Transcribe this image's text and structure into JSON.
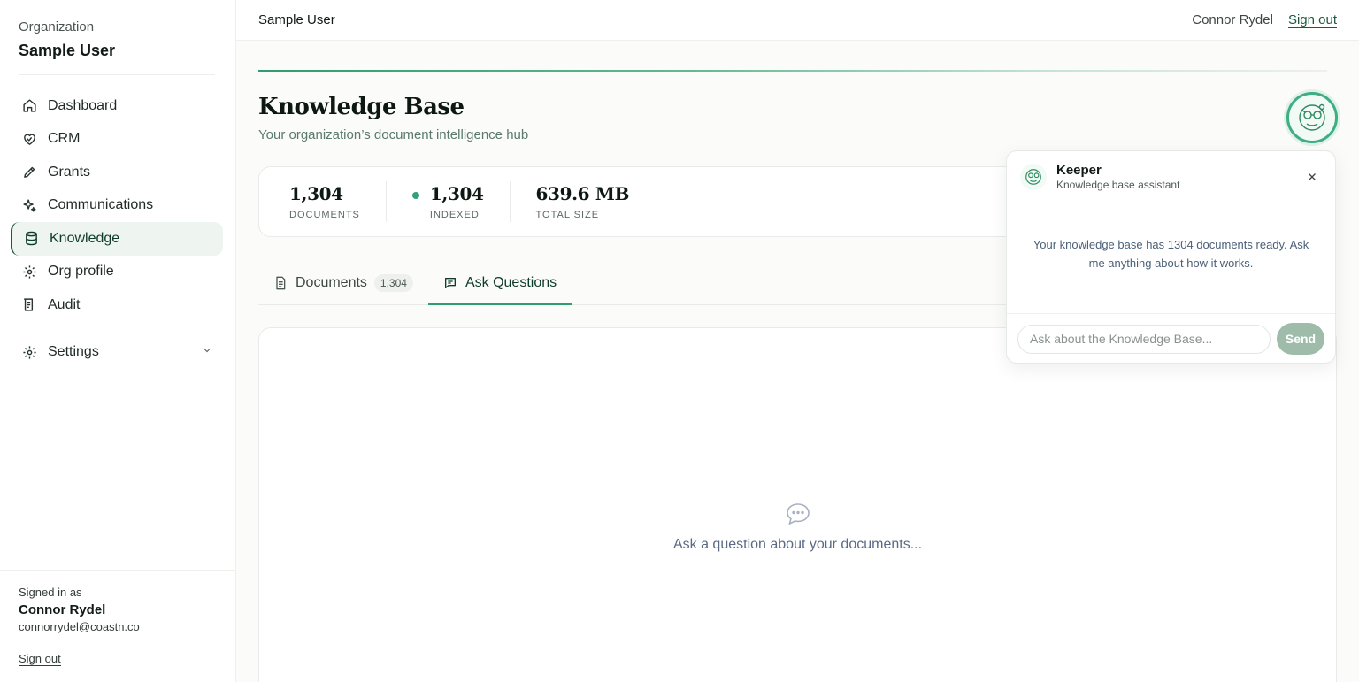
{
  "sidebar": {
    "org_label": "Organization",
    "org_name": "Sample User",
    "items": [
      {
        "label": "Dashboard",
        "icon": "home-icon"
      },
      {
        "label": "CRM",
        "icon": "handshake-icon"
      },
      {
        "label": "Grants",
        "icon": "pen-icon"
      },
      {
        "label": "Communications",
        "icon": "sparkle-icon"
      },
      {
        "label": "Knowledge",
        "icon": "database-icon",
        "active": true
      },
      {
        "label": "Org profile",
        "icon": "gear-icon"
      },
      {
        "label": "Audit",
        "icon": "audit-icon"
      }
    ],
    "settings_label": "Settings",
    "signed_in_label": "Signed in as",
    "user_name": "Connor Rydel",
    "user_email": "connorrydel@coastn.co",
    "sign_out": "Sign out"
  },
  "topbar": {
    "title": "Sample User",
    "user": "Connor Rydel",
    "sign_out": "Sign out"
  },
  "page": {
    "title": "Knowledge Base",
    "subtitle": "Your organization’s document intelligence hub"
  },
  "stats": {
    "documents_value": "1,304",
    "documents_label": "DOCUMENTS",
    "indexed_value": "1,304",
    "indexed_label": "INDEXED",
    "size_value": "639.6 MB",
    "size_label": "TOTAL SIZE"
  },
  "tabs": {
    "documents_label": "Documents",
    "documents_count": "1,304",
    "ask_label": "Ask Questions"
  },
  "chat": {
    "empty_text": "Ask a question about your documents..."
  },
  "assistant": {
    "name": "Keeper",
    "role": "Knowledge base assistant",
    "message": "Your knowledge base has 1304 documents ready. Ask me anything about how it works.",
    "input_placeholder": "Ask about the Knowledge Base...",
    "send_label": "Send"
  },
  "colors": {
    "accent": "#2f9d70",
    "active_nav_bg": "#eef5f1",
    "send_button": "#9fbcab"
  }
}
